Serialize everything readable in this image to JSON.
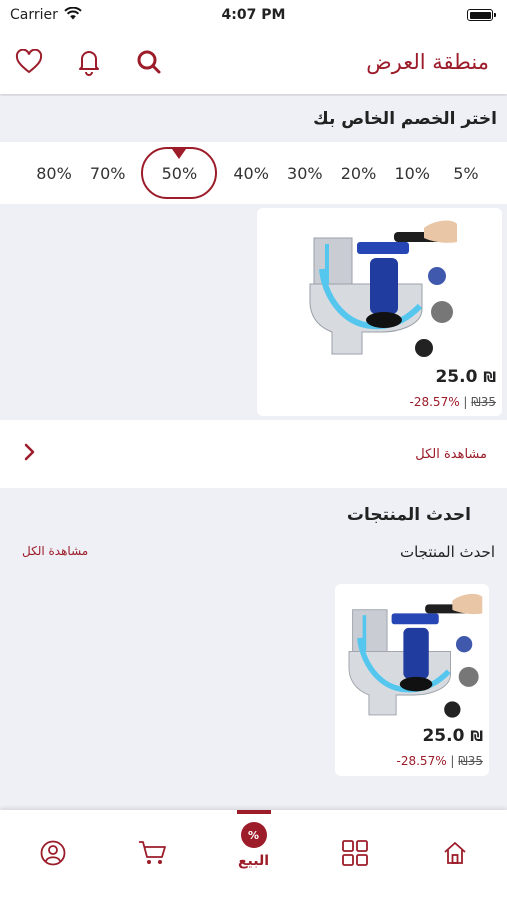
{
  "status_bar": {
    "carrier": "Carrier",
    "time": "4:07 PM"
  },
  "header": {
    "title": "منطقة العرض",
    "icons": [
      "heart-icon",
      "bell-icon",
      "search-icon"
    ]
  },
  "discount": {
    "title": "اختر الخصم الخاص بك",
    "options": [
      "80%",
      "70%",
      "50%",
      "40%",
      "30%",
      "20%",
      "10%",
      "5%"
    ],
    "selected": "50%"
  },
  "offer_products": [
    {
      "image": "drain-plunger-image",
      "price": "25.0",
      "currency": "₪",
      "old_price": "35",
      "discount_text": "28.57%-"
    }
  ],
  "see_all_label": "مشاهدة الكل",
  "latest_section": {
    "title": "احدث المنتجات",
    "subtitle": "احدث المنتجات",
    "see_all_label": "مشاهدة الكل",
    "products": [
      {
        "image": "drain-plunger-image",
        "price": "25.0",
        "currency": "₪",
        "old_price": "35",
        "discount_text": "28.57%-"
      }
    ]
  },
  "tabbar": {
    "active_tab": "sale",
    "sale_label": "البيع",
    "icons": [
      "profile-icon",
      "cart-icon",
      "sale-icon",
      "categories-icon",
      "home-icon"
    ]
  },
  "colors": {
    "accent": "#9c1c2a",
    "background": "#eef0f6",
    "card": "#ffffff"
  }
}
